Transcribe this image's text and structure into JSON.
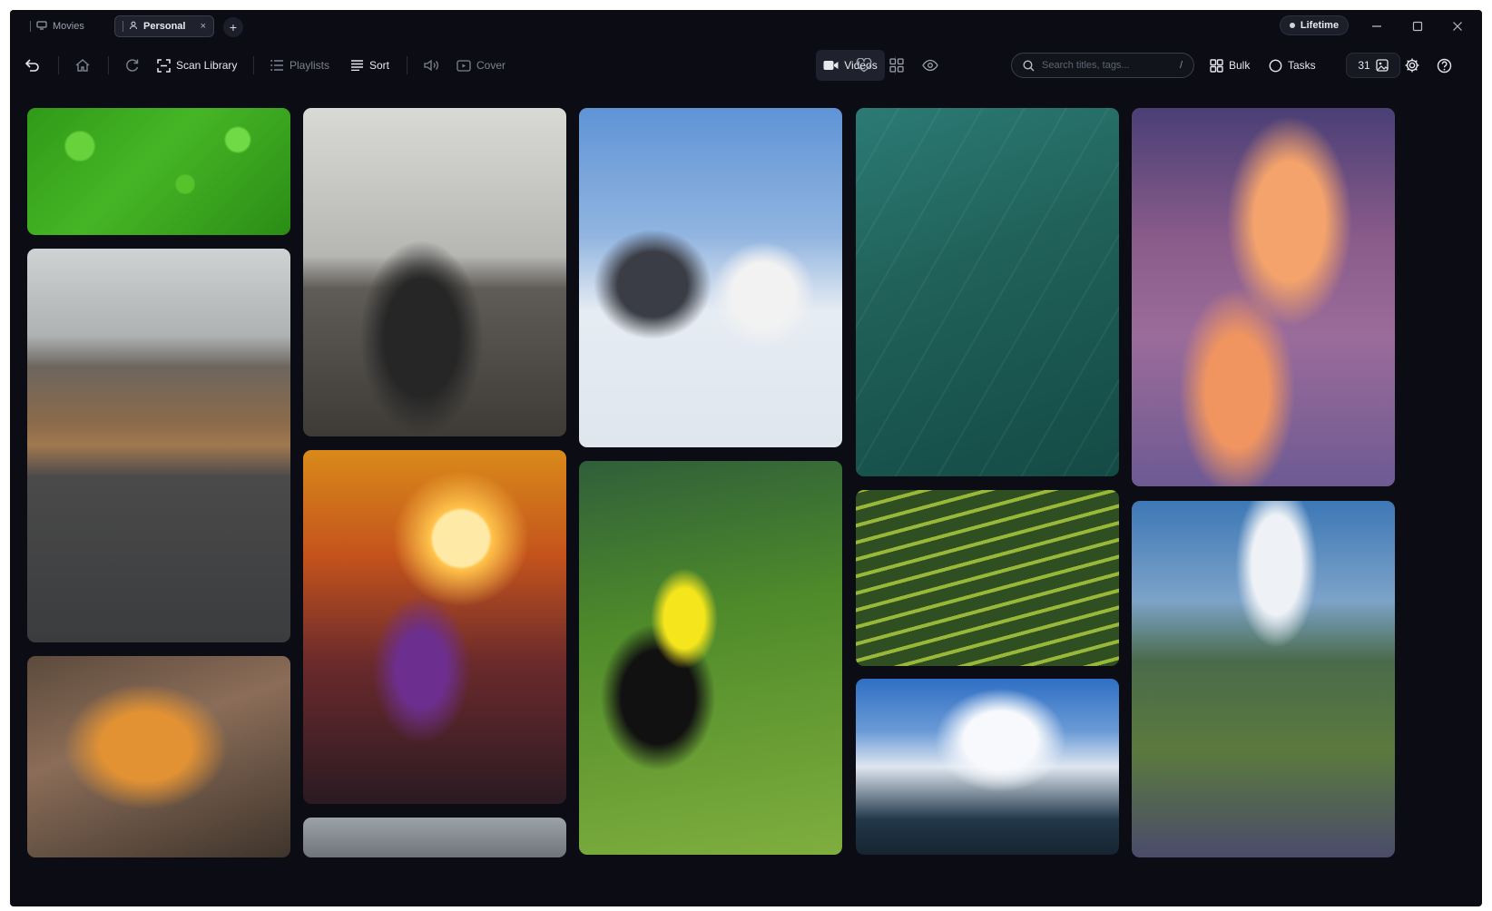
{
  "titlebar": {
    "tabs": [
      {
        "label": "Movies",
        "icon": "tv-icon"
      },
      {
        "label": "Personal",
        "icon": "user-icon",
        "active": true
      }
    ],
    "add_tab_label": "+",
    "close_tab_label": "×",
    "plan_badge": "Lifetime"
  },
  "toolbar": {
    "scan_library": "Scan Library",
    "playlists": "Playlists",
    "sort": "Sort",
    "cover": "Cover",
    "videos": "Videos",
    "search_placeholder": "Search titles, tags...",
    "search_shortcut": "/",
    "bulk": "Bulk",
    "tasks": "Tasks",
    "image_count": "31"
  },
  "gallery": {
    "items": [
      {
        "subject": "clover"
      },
      {
        "subject": "road"
      },
      {
        "subject": "tiger"
      },
      {
        "subject": "rider"
      },
      {
        "subject": "sunset-flower"
      },
      {
        "subject": "partial"
      },
      {
        "subject": "penguins"
      },
      {
        "subject": "toucan"
      },
      {
        "subject": "leaf"
      },
      {
        "subject": "terraces"
      },
      {
        "subject": "snow-mountain"
      },
      {
        "subject": "sunset-sky"
      },
      {
        "subject": "alps"
      }
    ]
  },
  "colors": {
    "background": "#0c0d14",
    "surface": "#1f222d",
    "text": "#e6e8ee",
    "muted": "#7d8290"
  }
}
